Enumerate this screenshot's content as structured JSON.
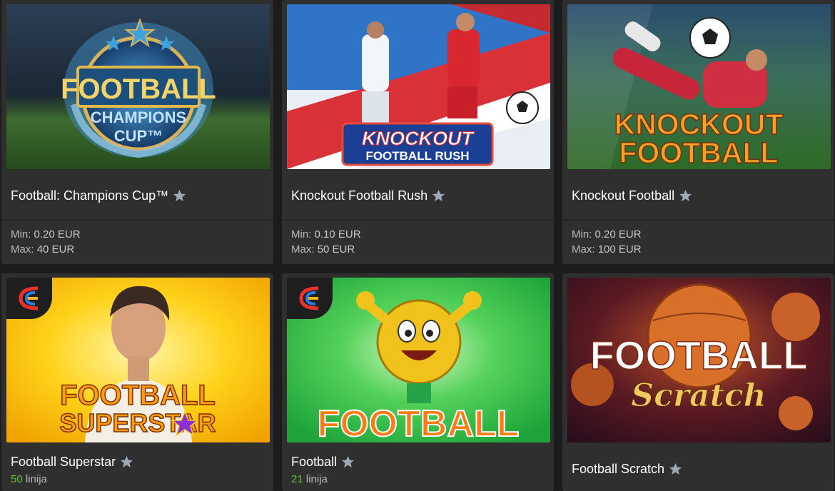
{
  "games": [
    {
      "title": "Football: Champions Cup™",
      "min_label": "Min:",
      "min_value": "0.20 EUR",
      "max_label": "Max:",
      "max_value": "40 EUR",
      "star_icon": "favorite-star-icon"
    },
    {
      "title": "Knockout Football Rush",
      "min_label": "Min:",
      "min_value": "0.10 EUR",
      "max_label": "Max:",
      "max_value": "50 EUR",
      "star_icon": "favorite-star-icon"
    },
    {
      "title": "Knockout Football",
      "min_label": "Min:",
      "min_value": "0.20 EUR",
      "max_label": "Max:",
      "max_value": "100 EUR",
      "star_icon": "favorite-star-icon"
    },
    {
      "title": "Football Superstar",
      "lines_count": "50",
      "lines_label": "linija",
      "provider_badge": "provider-logo-icon"
    },
    {
      "title": "Football",
      "lines_count": "21",
      "lines_label": "linija",
      "provider_badge": "provider-logo-icon"
    },
    {
      "title": "Football Scratch"
    }
  ],
  "thumbnail_text": {
    "g1_line1": "FOOTBALL",
    "g1_line2": "CHAMPIONS",
    "g1_line3": "CUP™",
    "g2_line1": "KNOCKOUT",
    "g2_line2": "FOOTBALL RUSH",
    "g3_line1": "KNOCKOUT",
    "g3_line2": "FOOTBALL",
    "g4_line1": "FOOTBALL",
    "g4_line2": "SUPERSTAR",
    "g5_line1": "FOOTBALL",
    "g6_line1": "FOOTBALL",
    "g6_line2": "Scratch"
  },
  "colors": {
    "card_bg": "#2f2f2f",
    "page_bg": "#1c1c1c",
    "lines_count_color": "#6abf3c"
  }
}
